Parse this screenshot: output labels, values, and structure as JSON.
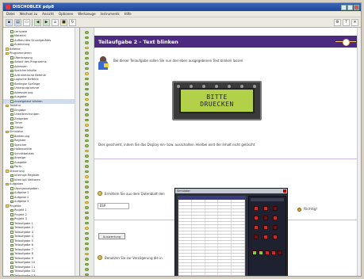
{
  "window": {
    "title": "DISCHOBLEX pdp8",
    "buttons": [
      "minimize",
      "maximize",
      "close"
    ]
  },
  "menu": [
    "Datei",
    "Wechsel zu",
    "Ansicht",
    "Optionen",
    "Werkzeuge",
    "Instruments",
    "Hilfe"
  ],
  "toolbar": {
    "left_icons": [
      "new-icon",
      "save-icon",
      "print-icon",
      "back-icon",
      "forward-icon",
      "home-icon",
      "stop-icon",
      "refresh-icon"
    ],
    "right_icons": [
      "gear-icon",
      "help-icon",
      "exit-icon"
    ]
  },
  "tree": {
    "items": [
      {
        "label": "Lernziele",
        "folder": false
      },
      {
        "label": "Material",
        "folder": false
      },
      {
        "label": "Aufbau des Grundgerätes",
        "folder": false
      },
      {
        "label": "Anbindung",
        "folder": false
      },
      {
        "label": "Befehle",
        "folder": true
      },
      {
        "label": "Programmieren",
        "folder": true
      },
      {
        "label": "Übertragung",
        "folder": false
      },
      {
        "label": "Ablauf des Programms",
        "folder": false
      },
      {
        "label": "Adressen",
        "folder": false
      },
      {
        "label": "Speicherinhalte",
        "folder": false
      },
      {
        "label": "Arithmetische Befehle",
        "folder": false
      },
      {
        "label": "Logische Befehle",
        "folder": false
      },
      {
        "label": "Bedingte Sprünge",
        "folder": false
      },
      {
        "label": "Unterprogramme",
        "folder": false
      },
      {
        "label": "Adressierung",
        "folder": false
      },
      {
        "label": "Ausgabe",
        "folder": false
      },
      {
        "label": "Anzeigetext blinken",
        "folder": false
      },
      {
        "label": "Tastatur",
        "folder": true
      },
      {
        "label": "Eingabe",
        "folder": false
      },
      {
        "label": "Unterbrechungen",
        "folder": false
      },
      {
        "label": "Zeitgeber",
        "folder": false
      },
      {
        "label": "Timer",
        "folder": false
      },
      {
        "label": "Zähler",
        "folder": false
      },
      {
        "label": "Simulator",
        "folder": true
      },
      {
        "label": "Bedienung",
        "folder": false
      },
      {
        "label": "Register",
        "folder": false
      },
      {
        "label": "Speicher",
        "folder": false
      },
      {
        "label": "Haltepunkte",
        "folder": false
      },
      {
        "label": "Schrittbetrieb",
        "folder": false
      },
      {
        "label": "Anzeige",
        "folder": false
      },
      {
        "label": "Ausgabe",
        "folder": false
      },
      {
        "label": "Ports",
        "folder": false
      },
      {
        "label": "Steuerung",
        "folder": true
      },
      {
        "label": "Interrupt Register",
        "folder": false
      },
      {
        "label": "Interrupt Vektoren",
        "folder": false
      },
      {
        "label": "Aufgaben",
        "folder": true
      },
      {
        "label": "Übungsaufgaben",
        "folder": false
      },
      {
        "label": "Aufgabe 1",
        "folder": false
      },
      {
        "label": "Aufgabe 2",
        "folder": false
      },
      {
        "label": "Aufgabe 3",
        "folder": false
      },
      {
        "label": "Projekte",
        "folder": true
      },
      {
        "label": "Projekt 1",
        "folder": false
      },
      {
        "label": "Projekt 2",
        "folder": false
      },
      {
        "label": "Projekt 3",
        "folder": false
      },
      {
        "label": "Teilaufgabe 1",
        "folder": false
      },
      {
        "label": "Teilaufgabe 2",
        "folder": false
      },
      {
        "label": "Teilaufgabe 3",
        "folder": false
      },
      {
        "label": "Teilaufgabe 4",
        "folder": false
      },
      {
        "label": "Teilaufgabe 5",
        "folder": false
      },
      {
        "label": "Teilaufgabe 6",
        "folder": false
      },
      {
        "label": "Teilaufgabe 7",
        "folder": false
      },
      {
        "label": "Teilaufgabe 8",
        "folder": false
      },
      {
        "label": "Teilaufgabe 9",
        "folder": false
      },
      {
        "label": "Teilaufgabe 10",
        "folder": false
      },
      {
        "label": "Teilaufgabe 11",
        "folder": false
      },
      {
        "label": "Teilaufgabe 12",
        "folder": false
      },
      {
        "label": "Teilaufgabe 13",
        "folder": false
      },
      {
        "label": "Teilaufgabe 14",
        "folder": false
      }
    ]
  },
  "page": {
    "title": "Teilaufgabe 2 - Text blinken",
    "intro": "Bei dieser Teilaufgabe sollen Sie nun den eben ausgegebenen Text blinken lassen",
    "lcd_line1": "BITTE",
    "lcd_line2": "DRUECKEN",
    "paragraph2": "Dies geschieht, indem Sie das Display ein- bzw. ausschalten. Hierbei wird der Inhalt nicht gelöscht",
    "question": "Ermitteln Sie aus dem Datenblatt den",
    "answer": "DSP",
    "check_button": "Auswertung",
    "result": "Richtig!",
    "footer_text": "Benutzen Sie zur Verzögerung die in"
  },
  "simulator": {
    "title": "Simulator",
    "keys": [
      "key-1",
      "key-2",
      "key-3",
      "key-4",
      "key-5",
      "key-6",
      "key-7",
      "key-8"
    ]
  }
}
